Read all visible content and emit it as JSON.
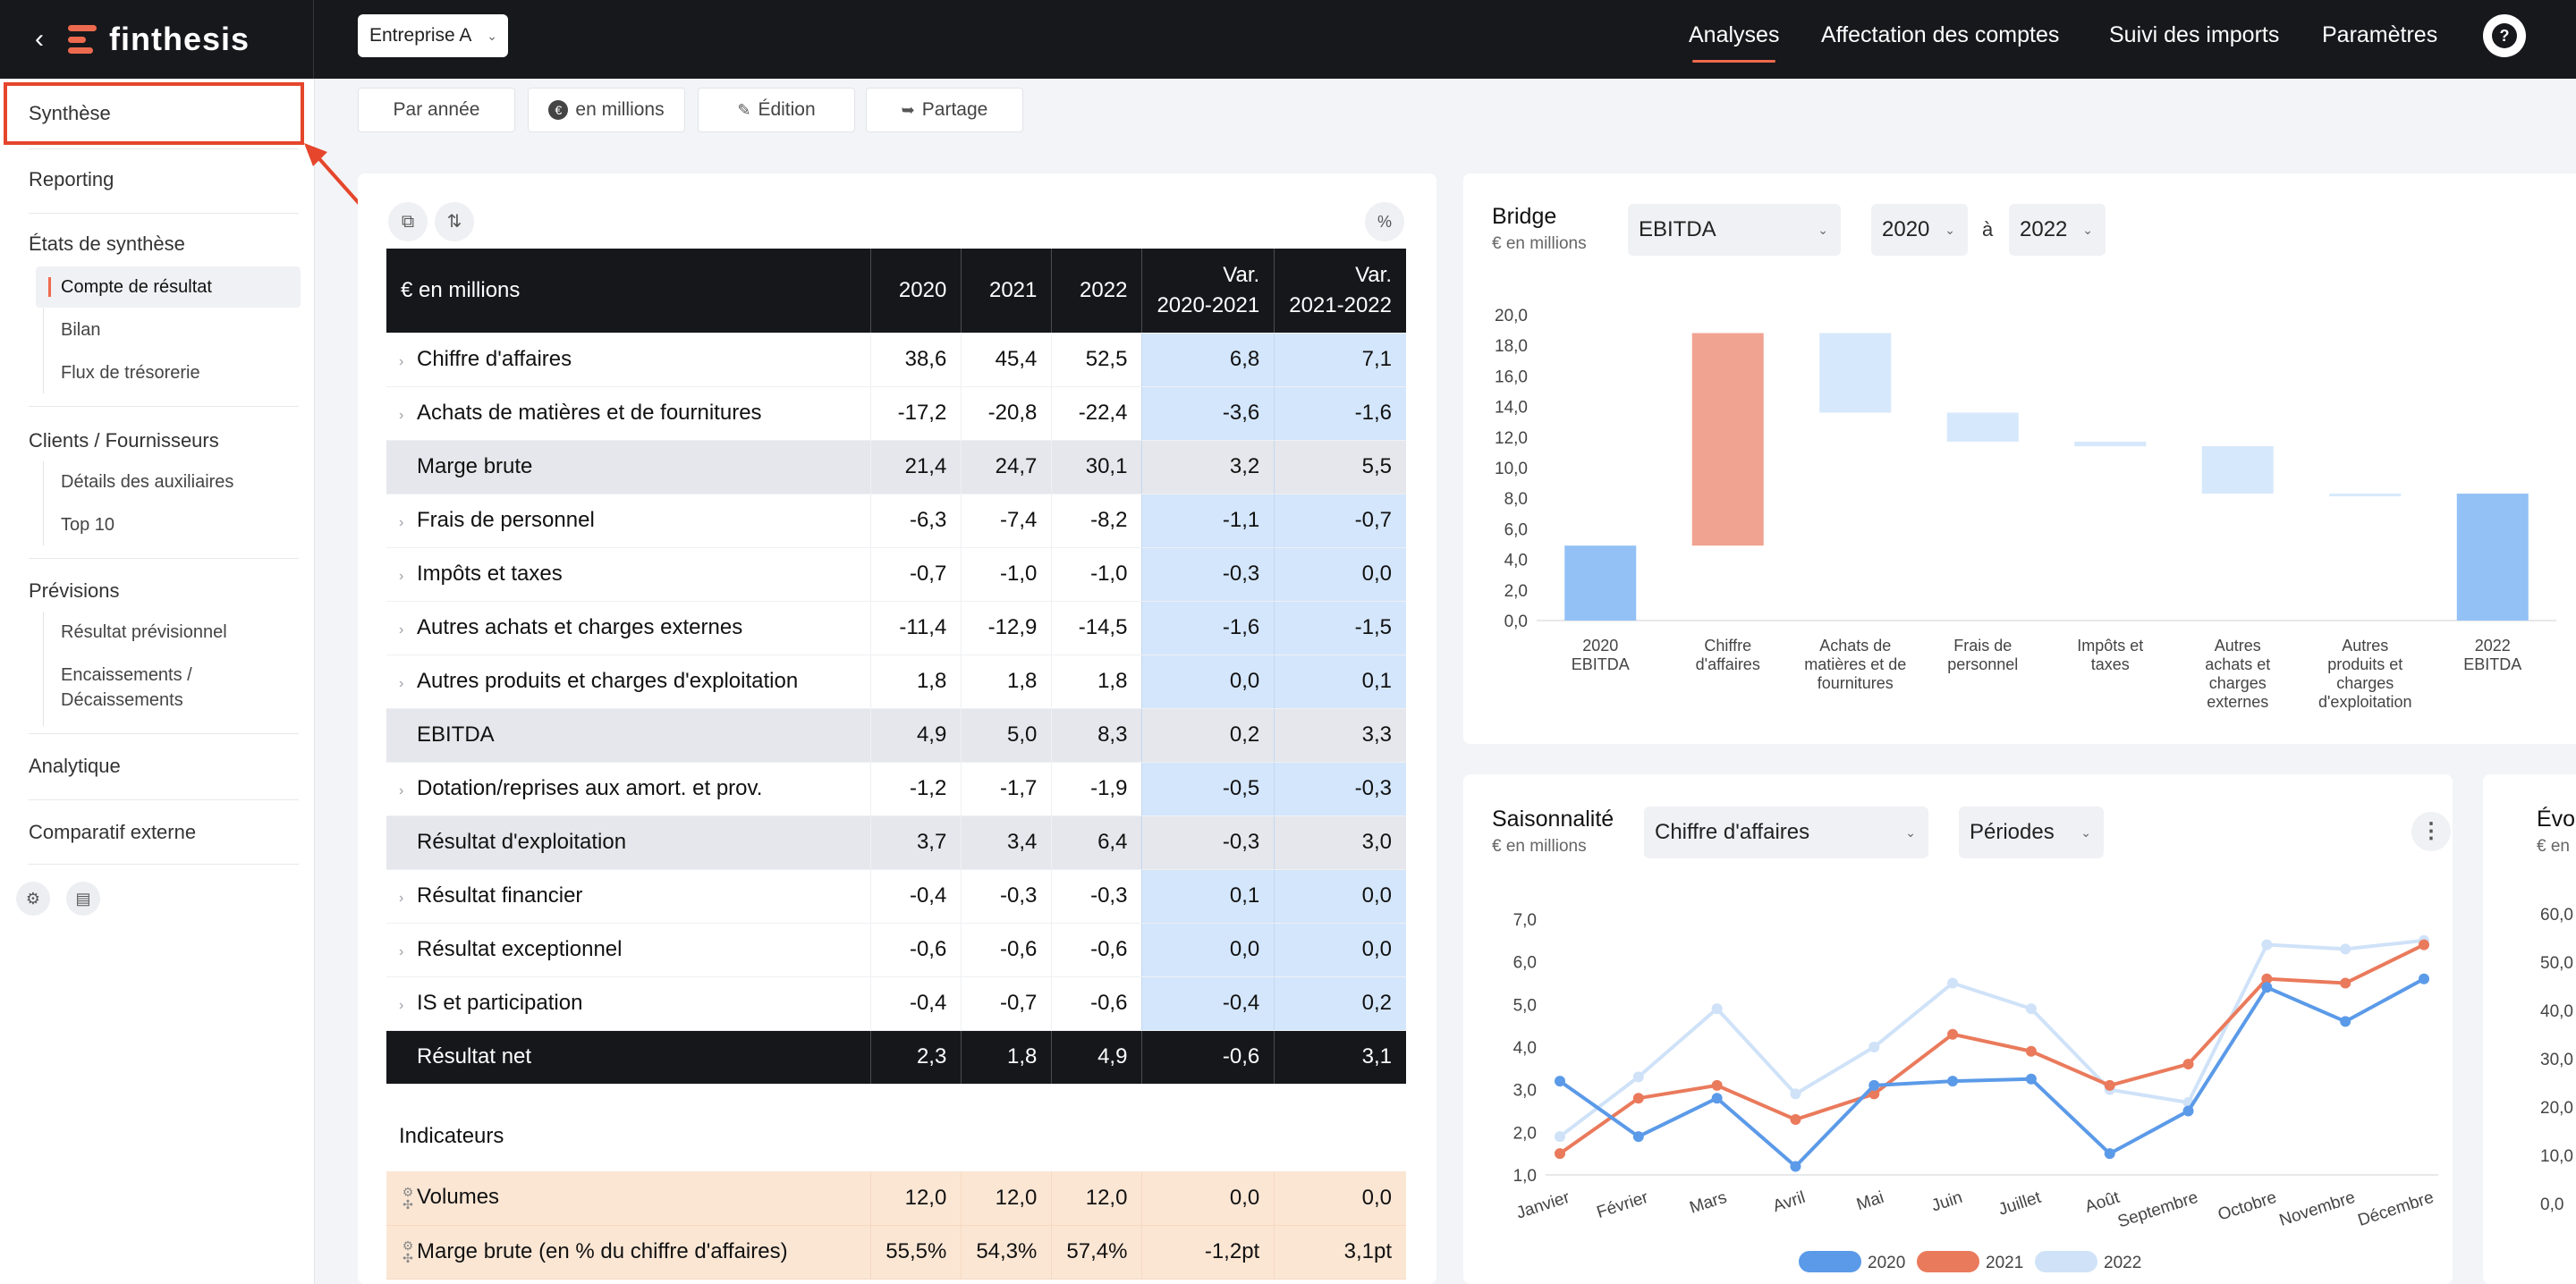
{
  "topbar": {
    "brand": "finthesis",
    "company_select": "Entreprise A",
    "nav": [
      {
        "label": "Analyses",
        "active": true
      },
      {
        "label": "Affectation des comptes",
        "active": false
      },
      {
        "label": "Suivi des imports",
        "active": false
      },
      {
        "label": "Paramètres",
        "active": false
      }
    ],
    "help": "?"
  },
  "sidebar": {
    "synthese": "Synthèse",
    "reporting": "Reporting",
    "etats_title": "États de synthèse",
    "etats_items": [
      "Compte de résultat",
      "Bilan",
      "Flux de trésorerie"
    ],
    "clients_title": "Clients / Fournisseurs",
    "clients_items": [
      "Détails des auxiliaires",
      "Top 10"
    ],
    "previsions_title": "Prévisions",
    "previsions_items": [
      "Résultat prévisionnel",
      "Encaissements /",
      "Décaissements"
    ],
    "analytique": "Analytique",
    "comparatif": "Comparatif externe"
  },
  "toolbar": {
    "par_annee": "Par année",
    "en_millions": "en millions",
    "edition": "Édition",
    "partage": "Partage"
  },
  "table": {
    "percent_btn": "%",
    "header": {
      "label": "€ en millions",
      "y2020": "2020",
      "y2021": "2021",
      "y2022": "2022",
      "var1_a": "Var.",
      "var1_b": "2020-2021",
      "var2_a": "Var.",
      "var2_b": "2021-2022"
    },
    "rows": [
      {
        "label": "Chiffre d'affaires",
        "v": [
          "38,6",
          "45,4",
          "52,5",
          "6,8",
          "7,1"
        ]
      },
      {
        "label": "Achats de matières et de fournitures",
        "v": [
          "-17,2",
          "-20,8",
          "-22,4",
          "-3,6",
          "-1,6"
        ]
      },
      {
        "label": "Marge brute",
        "v": [
          "21,4",
          "24,7",
          "30,1",
          "3,2",
          "5,5"
        ]
      },
      {
        "label": "Frais de personnel",
        "v": [
          "-6,3",
          "-7,4",
          "-8,2",
          "-1,1",
          "-0,7"
        ]
      },
      {
        "label": "Impôts et taxes",
        "v": [
          "-0,7",
          "-1,0",
          "-1,0",
          "-0,3",
          "0,0"
        ]
      },
      {
        "label": "Autres achats et charges externes",
        "v": [
          "-11,4",
          "-12,9",
          "-14,5",
          "-1,6",
          "-1,5"
        ]
      },
      {
        "label": "Autres produits et charges d'exploitation",
        "v": [
          "1,8",
          "1,8",
          "1,8",
          "0,0",
          "0,1"
        ]
      },
      {
        "label": "EBITDA",
        "v": [
          "4,9",
          "5,0",
          "8,3",
          "0,2",
          "3,3"
        ]
      },
      {
        "label": "Dotation/reprises aux amort. et prov.",
        "v": [
          "-1,2",
          "-1,7",
          "-1,9",
          "-0,5",
          "-0,3"
        ]
      },
      {
        "label": "Résultat d'exploitation",
        "v": [
          "3,7",
          "3,4",
          "6,4",
          "-0,3",
          "3,0"
        ]
      },
      {
        "label": "Résultat financier",
        "v": [
          "-0,4",
          "-0,3",
          "-0,3",
          "0,1",
          "0,0"
        ]
      },
      {
        "label": "Résultat exceptionnel",
        "v": [
          "-0,6",
          "-0,6",
          "-0,6",
          "0,0",
          "0,0"
        ]
      },
      {
        "label": "IS et participation",
        "v": [
          "-0,4",
          "-0,7",
          "-0,6",
          "-0,4",
          "0,2"
        ]
      },
      {
        "label": "Résultat net",
        "v": [
          "2,3",
          "1,8",
          "4,9",
          "-0,6",
          "3,1"
        ]
      }
    ],
    "indicators_title": "Indicateurs",
    "indicators": [
      {
        "label": "Volumes",
        "v": [
          "12,0",
          "12,0",
          "12,0",
          "0,0",
          "0,0"
        ]
      },
      {
        "label": "Marge brute (en % du chiffre d'affaires)",
        "v": [
          "55,5%",
          "54,3%",
          "57,4%",
          "-1,2pt",
          "3,1pt"
        ]
      }
    ]
  },
  "bridge": {
    "title": "Bridge",
    "subtitle": "€ en millions",
    "metric": "EBITDA",
    "from": "2020",
    "between": "à",
    "to": "2022"
  },
  "seasonality": {
    "title": "Saisonnalité",
    "subtitle": "€ en millions",
    "metric": "Chiffre d'affaires",
    "period": "Périodes",
    "menu": "⋮"
  },
  "evolution": {
    "title": "Évol",
    "subtitle": "€ en",
    "ticks": [
      "60,0",
      "50,0",
      "40,0",
      "30,0",
      "20,0",
      "10,0",
      "0,0"
    ]
  },
  "colors": {
    "accent": "#ee6a4e",
    "bar_blue": "#93c1f5",
    "bar_light": "#d6e8fb",
    "bar_red": "#f0a391",
    "line_2020": "#5b9ae8",
    "line_2021": "#ea7a5c",
    "line_2022": "#cfe2f8"
  },
  "chart_data": [
    {
      "type": "bar",
      "subtype": "waterfall",
      "title": "Bridge",
      "ylabel": "€ en millions",
      "categories": [
        "2020 EBITDA",
        "Chiffre d'affaires",
        "Achats de matières et de fournitures",
        "Frais de personnel",
        "Impôts et taxes",
        "Autres achats et charges externes",
        "Autres produits et charges d'exploitation",
        "2022 EBITDA"
      ],
      "category_lines": [
        [
          "2020",
          "EBITDA"
        ],
        [
          "Chiffre",
          "d'affaires"
        ],
        [
          "Achats de",
          "matières et de",
          "fournitures"
        ],
        [
          "Frais de",
          "personnel"
        ],
        [
          "Impôts et",
          "taxes"
        ],
        [
          "Autres",
          "achats et",
          "charges",
          "externes"
        ],
        [
          "Autres",
          "produits et",
          "charges",
          "d'exploitation"
        ],
        [
          "2022",
          "EBITDA"
        ]
      ],
      "values": [
        4.9,
        13.9,
        -5.2,
        -1.9,
        -0.3,
        -3.1,
        0.0,
        8.3
      ],
      "kinds": [
        "total",
        "increase",
        "decrease",
        "decrease",
        "decrease",
        "decrease",
        "decrease",
        "total"
      ],
      "ylim": [
        0,
        20
      ],
      "yticks": [
        "0,0",
        "2,0",
        "4,0",
        "6,0",
        "8,0",
        "10,0",
        "12,0",
        "14,0",
        "16,0",
        "18,0",
        "20,0"
      ]
    },
    {
      "type": "line",
      "title": "Saisonnalité",
      "ylabel": "€ en millions",
      "categories": [
        "Janvier",
        "Février",
        "Mars",
        "Avril",
        "Mai",
        "Juin",
        "Juillet",
        "Août",
        "Septembre",
        "Octobre",
        "Novembre",
        "Décembre"
      ],
      "ylim": [
        1,
        7
      ],
      "yticks": [
        "1,0",
        "2,0",
        "3,0",
        "4,0",
        "5,0",
        "6,0",
        "7,0"
      ],
      "series": [
        {
          "name": "2020",
          "values": [
            3.2,
            1.9,
            2.8,
            1.2,
            3.1,
            3.2,
            3.25,
            1.5,
            2.5,
            5.4,
            4.6,
            5.6
          ]
        },
        {
          "name": "2021",
          "values": [
            1.5,
            2.8,
            3.1,
            2.3,
            2.9,
            4.3,
            3.9,
            3.1,
            3.6,
            5.6,
            5.5,
            6.4
          ]
        },
        {
          "name": "2022",
          "values": [
            1.9,
            3.3,
            4.9,
            2.9,
            4.0,
            5.5,
            4.9,
            3.0,
            2.7,
            6.4,
            6.3,
            6.5
          ]
        }
      ],
      "legend": "bottom"
    }
  ]
}
